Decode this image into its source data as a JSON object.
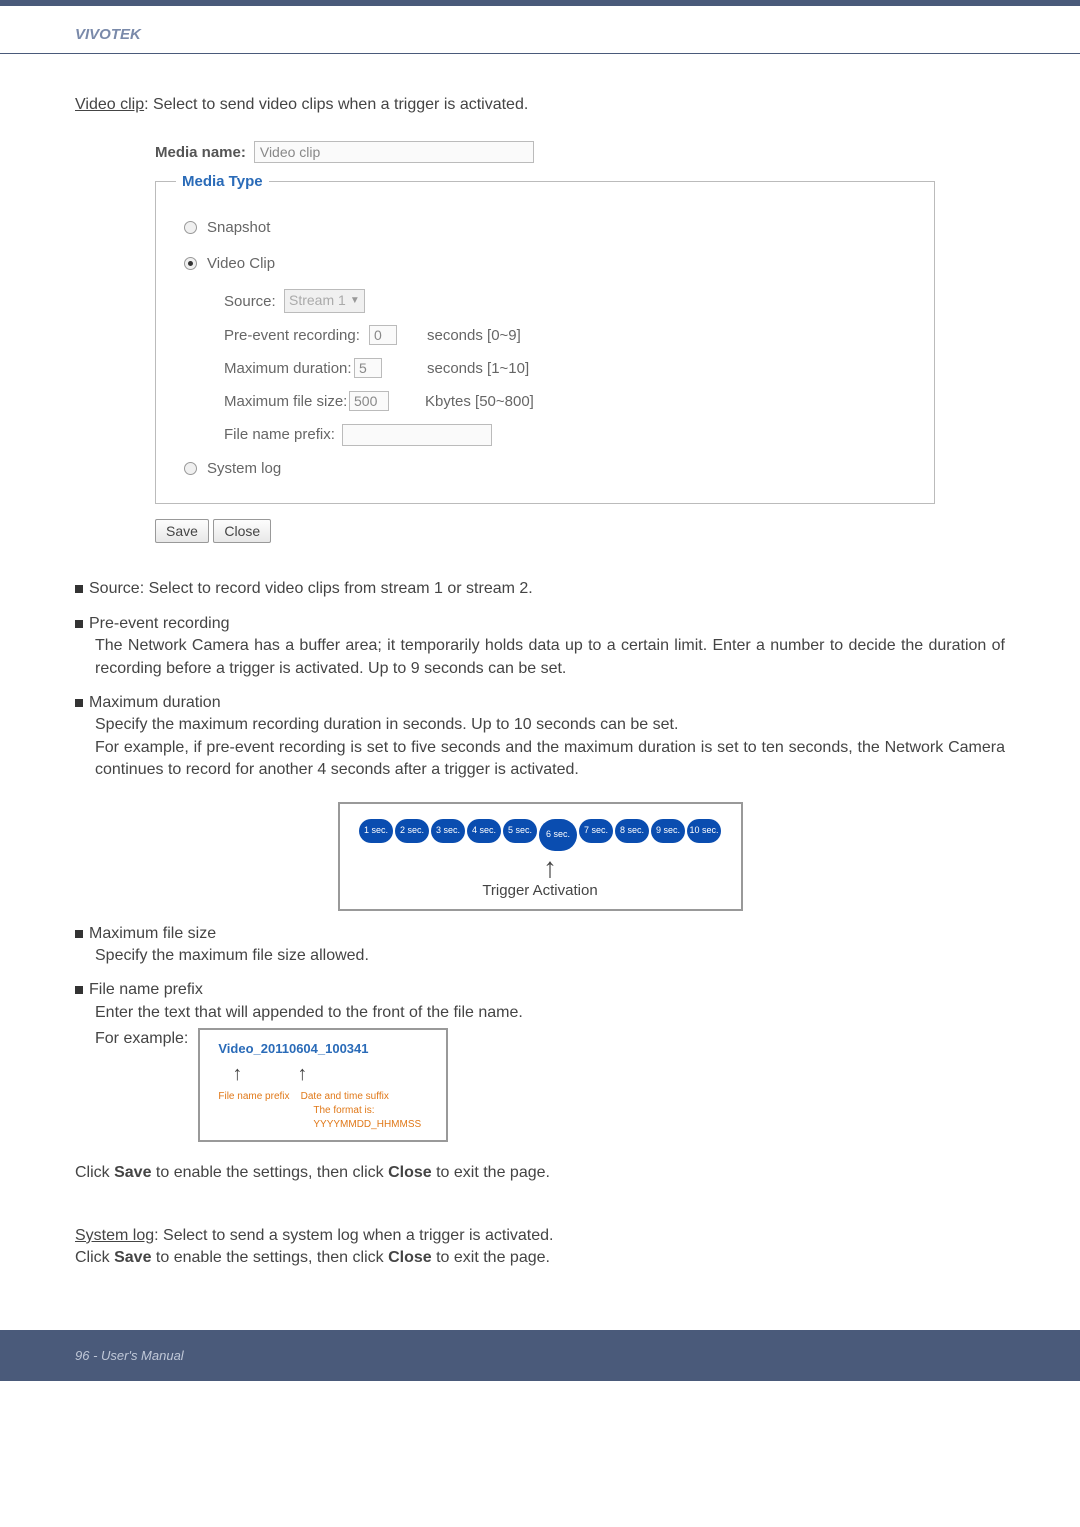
{
  "brand": "VIVOTEK",
  "intro": {
    "heading": "Video clip",
    "text": ": Select to send video clips when a trigger is activated."
  },
  "form": {
    "media_name_label": "Media name:",
    "media_name_value": "Video clip",
    "fieldset_legend": "Media Type",
    "radio_snapshot": "Snapshot",
    "radio_videoclip": "Video Clip",
    "radio_systemlog": "System log",
    "source_label": "Source:",
    "source_value": "Stream 1",
    "pre_event_label": "Pre-event recording:",
    "pre_event_value": "0",
    "pre_event_hint": "seconds [0~9]",
    "max_duration_label": "Maximum duration:",
    "max_duration_value": "5",
    "max_duration_hint": "seconds [1~10]",
    "max_filesize_label": "Maximum file size:",
    "max_filesize_value": "500",
    "max_filesize_hint": "Kbytes [50~800]",
    "filename_prefix_label": "File name prefix:",
    "save_btn": "Save",
    "close_btn": "Close"
  },
  "bullets": {
    "source": {
      "title": "Source:",
      "body": " Select to record video clips from stream 1 or stream 2."
    },
    "preevent": {
      "title": "Pre-event recording",
      "body": "The Network Camera has a buffer area; it temporarily holds data up to a certain limit. Enter a number to decide the duration of recording before a trigger is activated. Up to 9 seconds can be set."
    },
    "maxduration": {
      "title": "Maximum duration",
      "body1": "Specify the maximum recording duration in seconds. Up to 10 seconds can be set.",
      "body2": "For example, if pre-event recording is set to five seconds and the maximum duration is set to ten seconds, the Network Camera continues to record for another 4 seconds after a trigger is activated."
    },
    "maxfilesize": {
      "title": "Maximum file size",
      "body": "Specify the maximum file size allowed."
    },
    "fileprefix": {
      "title": "File name prefix",
      "body": "Enter the text that will appended to the front of the file name.",
      "example_label": "For example:"
    }
  },
  "timeline": {
    "secs": [
      "1 sec.",
      "2 sec.",
      "3 sec.",
      "4 sec.",
      "5 sec.",
      "6 sec.",
      "7 sec.",
      "8 sec.",
      "9 sec.",
      "10 sec."
    ],
    "caption": "Trigger Activation"
  },
  "prefix_example": {
    "filename": "Video_20110604_100341",
    "file_prefix_label": "File name prefix",
    "suffix_label": "Date and time suffix",
    "format_label": "The format is: YYYYMMDD_HHMMSS"
  },
  "save_close_text_1": "Click ",
  "save_bold": "Save",
  "save_close_text_2": " to enable the settings, then click ",
  "close_bold": "Close",
  "save_close_text_3": " to exit the page.",
  "system_log": {
    "heading": "System log",
    "text": ": Select to send a system log when a trigger is activated."
  },
  "footer": {
    "page": "96 - User's Manual"
  }
}
